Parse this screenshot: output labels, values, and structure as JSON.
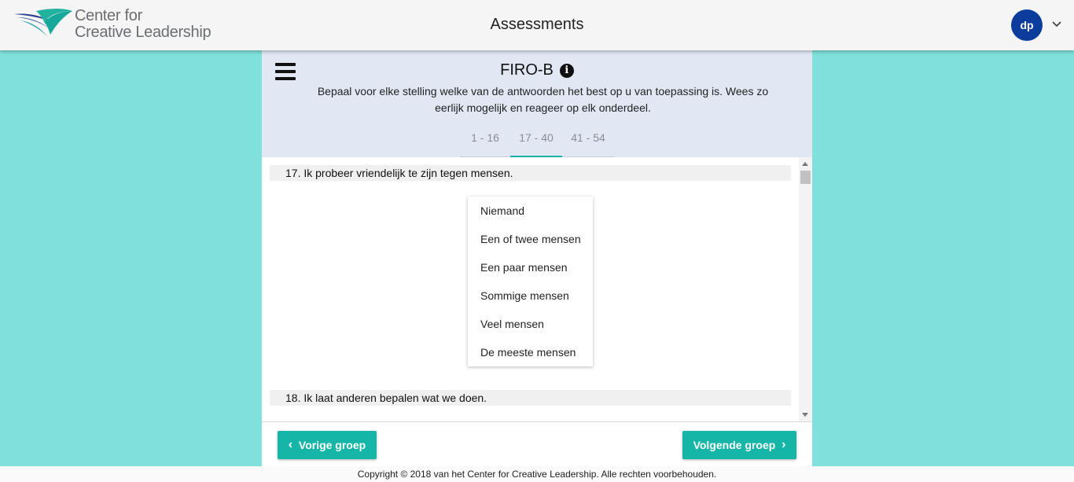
{
  "header": {
    "logo_line1": "Center for",
    "logo_line2": "Creative Leadership",
    "title": "Assessments",
    "avatar_initials": "dp",
    "account_icon": "chevron-down-icon"
  },
  "assessment": {
    "title": "FIRO-B",
    "menu_icon": "hamburger-menu-icon",
    "info_icon": "info-icon",
    "instructions": "Bepaal voor elke stelling welke van de antwoorden het best op u van toepassing is. Wees zo eerlijk mogelijk en reageer op elk onderdeel.",
    "tabs": [
      {
        "label": "1 - 16",
        "active": false
      },
      {
        "label": "17 - 40",
        "active": true
      },
      {
        "label": "41 - 54",
        "active": false
      }
    ]
  },
  "questions": [
    {
      "text": "17. Ik probeer vriendelijk te zijn tegen mensen."
    },
    {
      "text": "18. Ik laat anderen bepalen wat we doen."
    }
  ],
  "dropdown_options": [
    "Niemand",
    "Een of twee mensen",
    "Een paar mensen",
    "Sommige mensen",
    "Veel mensen",
    "De meeste mensen"
  ],
  "nav": {
    "prev_label": "Vorige groep",
    "next_label": "Volgende groep"
  },
  "footer": {
    "copyright": "Copyright © 2018 van het Center for Creative Leadership. Alle rechten voorbehouden."
  },
  "colors": {
    "background": "#80e0da",
    "accent": "#15b5a7",
    "avatar": "#0c3c9c",
    "panel_header": "#e1e8f4"
  }
}
